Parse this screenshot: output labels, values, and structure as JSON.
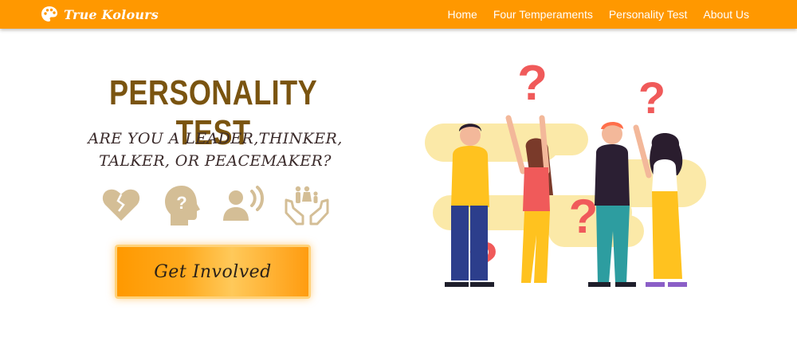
{
  "navbar": {
    "brand": "True Kolours",
    "links": [
      {
        "label": "Home"
      },
      {
        "label": "Four Temperaments"
      },
      {
        "label": "Personality Test"
      },
      {
        "label": "About Us"
      }
    ]
  },
  "hero": {
    "title": "PERSONALITY TEST",
    "subtitle_line1": "ARE YOU A LEADER,THINKER,",
    "subtitle_line2": "TALKER, OR PEACEMAKER?",
    "icons": [
      "heart-icon",
      "head-question-icon",
      "speaker-person-icon",
      "family-hands-icon"
    ],
    "cta_label": "Get Involved"
  },
  "colors": {
    "nav_bg": "#ff9800",
    "title": "#7a5410",
    "icon_tan": "#d4be96",
    "question_red": "#f05a5a",
    "blob_yellow": "#fbe9a8"
  }
}
